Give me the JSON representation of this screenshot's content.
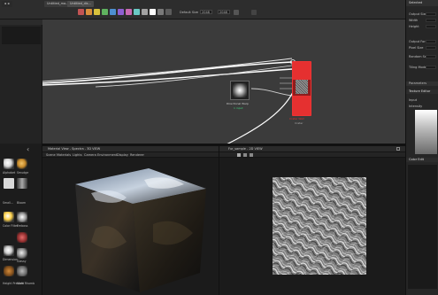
{
  "topbar": {
    "tabs": [
      "Untitled_ma...",
      "Untitled_dis..."
    ],
    "graph_tab": "graph",
    "toolbar": {
      "size_label": "Default Size",
      "size_value": "2048",
      "size_value2": "2048",
      "swatch_colors": [
        "#c25454",
        "#d98f3c",
        "#d9c23c",
        "#5fb25f",
        "#4d8fd1",
        "#8e5fd1",
        "#c96ab2",
        "#6ac9c4",
        "#a3a3a3",
        "#ffffff",
        "#7a7a7a",
        "#5c5c5c"
      ]
    }
  },
  "library": {
    "items": [
      {
        "label": "Alphabet"
      },
      {
        "label": "Smudge"
      },
      {
        "label": "Small..."
      },
      {
        "label": "Bloom"
      },
      {
        "label": "Color Filter"
      },
      {
        "label": "Emboss"
      },
      {
        "label": "Dimension"
      },
      {
        "label": "Glassy"
      },
      {
        "label": "Height Preview"
      },
      {
        "label": "Multi Rhomb"
      }
    ]
  },
  "graph": {
    "node_main": {
      "title": "Crater Wall",
      "subtitle": "Crater"
    },
    "node_small": {
      "title": "Directional Warp",
      "sub": "1 input"
    }
  },
  "view3d": {
    "title": "Material View - Spectra - 3D VIEW",
    "menu": [
      "Scene",
      "Materials",
      "Lights",
      "Camera",
      "Environment",
      "Display",
      "Renderer"
    ]
  },
  "view2d": {
    "title": "Fur_sample - 2D VIEW"
  },
  "rpanel": {
    "title": "Selected",
    "rows": [
      "Output Size",
      "Width",
      "Height",
      "Output Format",
      "Pixel Size",
      "Random Seed",
      "Tiling Mode",
      "Parameters",
      "Input",
      "Intensity"
    ],
    "section2": "Texture Editor",
    "section3": "Color Edit"
  }
}
